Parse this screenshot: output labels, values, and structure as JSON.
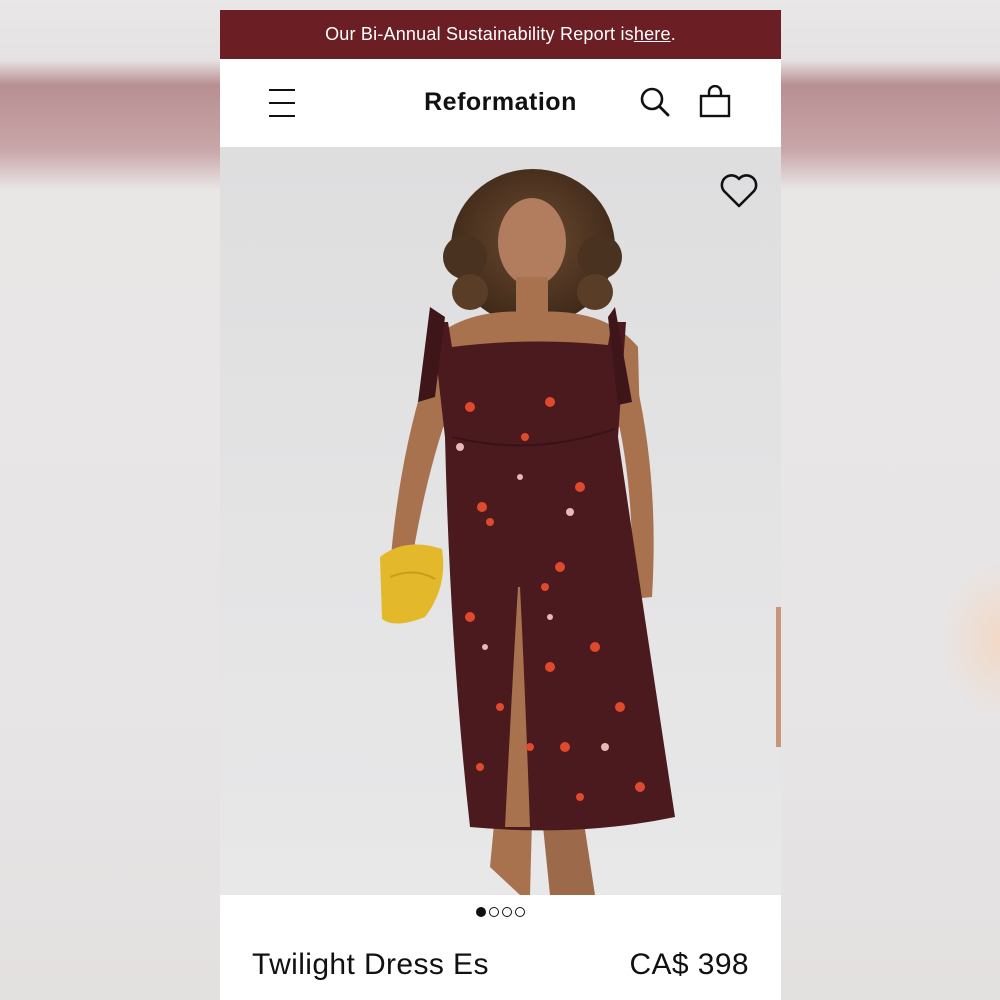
{
  "banner": {
    "text_prefix": "Our Bi-Annual Sustainability Report is ",
    "link_text": "here",
    "text_suffix": "."
  },
  "header": {
    "brand": "Reformation",
    "icons": [
      "menu-icon",
      "search-icon",
      "bag-icon"
    ]
  },
  "gallery": {
    "wishlist_icon": "heart-icon",
    "slide_count": 4,
    "active_slide": 1
  },
  "product": {
    "name": "Twilight Dress Es",
    "price": "CA$ 398"
  },
  "colors": {
    "banner_bg": "#6b1f24",
    "dress": "#4a1a1e",
    "flower_accent": "#e04a2c",
    "clutch": "#e3b82a",
    "text": "#111111"
  }
}
